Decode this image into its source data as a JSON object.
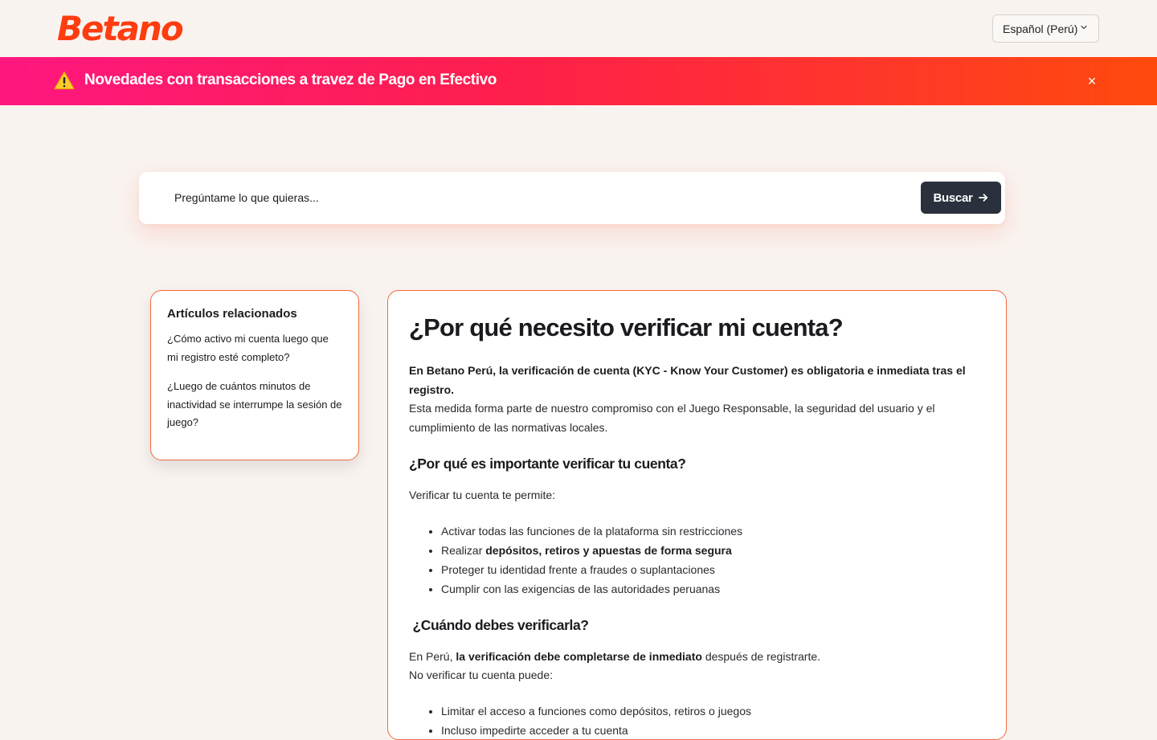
{
  "header": {
    "logo_text": "Betano",
    "language_label": "Español (Perú)"
  },
  "banner": {
    "text": "Novedades con transacciones a travez de Pago en Efectivo",
    "close_label": "×"
  },
  "search": {
    "placeholder": "Pregúntame lo que quieras...",
    "button_label": "Buscar"
  },
  "related": {
    "title": "Artículos relacionados",
    "links": [
      "¿Cómo activo mi cuenta luego que mi registro esté completo?",
      "¿Luego de cuántos minutos de inactividad se interrumpe la sesión de juego?"
    ]
  },
  "article": {
    "title": "¿Por qué necesito verificar mi cuenta?",
    "intro_bold": "En Betano Perú, la verificación de cuenta (KYC - Know Your Customer) es obligatoria e inmediata tras el registro.",
    "intro_text": "Esta medida forma parte de nuestro compromiso con el Juego Responsable, la seguridad del usuario y el cumplimiento de las normativas locales.",
    "section1_title": "¿Por qué es importante verificar tu cuenta?",
    "section1_lead": "Verificar tu cuenta te permite:",
    "section1_items": {
      "item1": "Activar todas las funciones de la plataforma sin restricciones",
      "item2_prefix": "Realizar ",
      "item2_bold": "depósitos, retiros y apuestas de forma segura",
      "item3": "Proteger tu identidad frente a fraudes o suplantaciones",
      "item4": "Cumplir con las exigencias de las autoridades peruanas"
    },
    "section2_title": " ¿Cuándo debes verificarla?",
    "section2_prefix": "En Perú, ",
    "section2_bold": "la verificación debe completarse de inmediato",
    "section2_suffix": " después de registrarte.",
    "section2_line2": "No verificar tu cuenta puede:",
    "section2_items": [
      "Limitar el acceso a funciones como depósitos, retiros o juegos",
      "Incluso impedirte acceder a tu cuenta"
    ]
  },
  "colors": {
    "brand": "#ff3d10",
    "banner_start": "#ff1780",
    "banner_end": "#ff4a0c",
    "button_bg": "#2a313d",
    "card_border": "#f2693f"
  },
  "icons": {
    "banner": "warning-icon",
    "close": "close-icon",
    "language": "chevron-down-icon",
    "search_button": "arrow-right-icon"
  }
}
